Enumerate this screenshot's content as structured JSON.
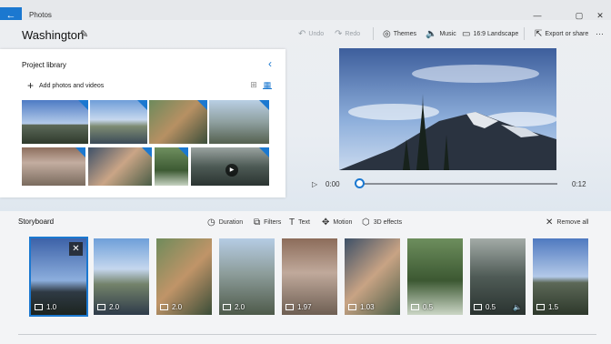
{
  "window": {
    "title": "Photos",
    "back": "←",
    "minimize": "—",
    "maximize": "▢",
    "close": "✕"
  },
  "project": {
    "title": "Washington"
  },
  "toolbar": {
    "undo": "Undo",
    "redo": "Redo",
    "themes": "Themes",
    "music": "Music",
    "aspect": "16:9 Landscape",
    "export": "Export or share",
    "more": "···"
  },
  "library": {
    "title": "Project library",
    "add": "Add photos and videos"
  },
  "player": {
    "current": "0:00",
    "total": "0:12",
    "progress": 0.0
  },
  "storyboard": {
    "title": "Storyboard",
    "tools": {
      "duration": "Duration",
      "filters": "Filters",
      "text": "Text",
      "motion": "Motion",
      "effects": "3D effects",
      "remove": "Remove all"
    },
    "clips": [
      {
        "duration": "1.0",
        "type": "image"
      },
      {
        "duration": "2.0",
        "type": "image"
      },
      {
        "duration": "2.0",
        "type": "image"
      },
      {
        "duration": "2.0",
        "type": "image"
      },
      {
        "duration": "1.97",
        "type": "image"
      },
      {
        "duration": "1.03",
        "type": "image"
      },
      {
        "duration": "0.5",
        "type": "image"
      },
      {
        "duration": "0.5",
        "type": "video"
      },
      {
        "duration": "1.5",
        "type": "image"
      }
    ]
  },
  "colors": {
    "accent": "#1b78d0"
  }
}
